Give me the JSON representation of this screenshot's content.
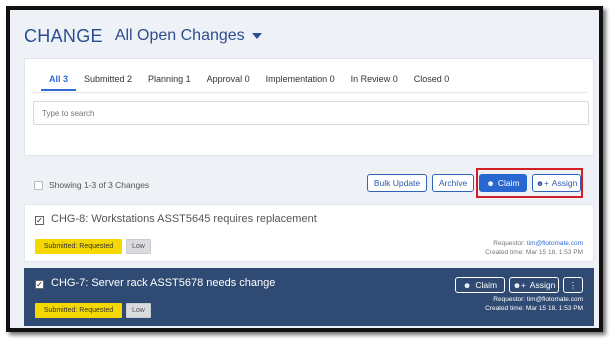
{
  "header": {
    "title": "CHANGE",
    "view": "All Open Changes"
  },
  "tabs": [
    {
      "label": "All 3",
      "active": true
    },
    {
      "label": "Submitted 2",
      "active": false
    },
    {
      "label": "Planning 1",
      "active": false
    },
    {
      "label": "Approval 0",
      "active": false
    },
    {
      "label": "Implementation 0",
      "active": false
    },
    {
      "label": "In Review 0",
      "active": false
    },
    {
      "label": "Closed 0",
      "active": false
    }
  ],
  "search": {
    "placeholder": "Type to search"
  },
  "list": {
    "showing": "Showing 1-3 of 3 Changes",
    "buttons": {
      "bulk_update": "Bulk Update",
      "archive": "Archive",
      "claim": "Claim",
      "assign": "Assign"
    }
  },
  "items": [
    {
      "title": "CHG-8: Workstations ASST5645 requires replacement",
      "status": "Submitted: Requested",
      "priority": "Low",
      "requestor_label": "Requestor:",
      "requestor": "tim@flotomate.com",
      "created": "Created time: Mar 15 18, 1:53 PM"
    },
    {
      "title": "CHG-7: Server rack ASST5678 needs change",
      "status": "Submitted: Requested",
      "priority": "Low",
      "requestor_label": "Requestor:",
      "requestor": "tim@flotomate.com",
      "created": "Created time: Mar 15 18, 1:53 PM",
      "actions": {
        "claim": "Claim",
        "assign": "Assign",
        "more": "⋮"
      }
    }
  ],
  "colors": {
    "accent": "#2867cf",
    "header": "#2e4d8f",
    "selected_row": "#2f4b73",
    "status": "#f5d800",
    "highlight": "#d21f26"
  },
  "icons": {
    "user": "user-icon",
    "user_plus": "user-plus-icon",
    "more": "more-vertical-icon",
    "caret": "caret-down-icon",
    "check": "check-icon"
  }
}
